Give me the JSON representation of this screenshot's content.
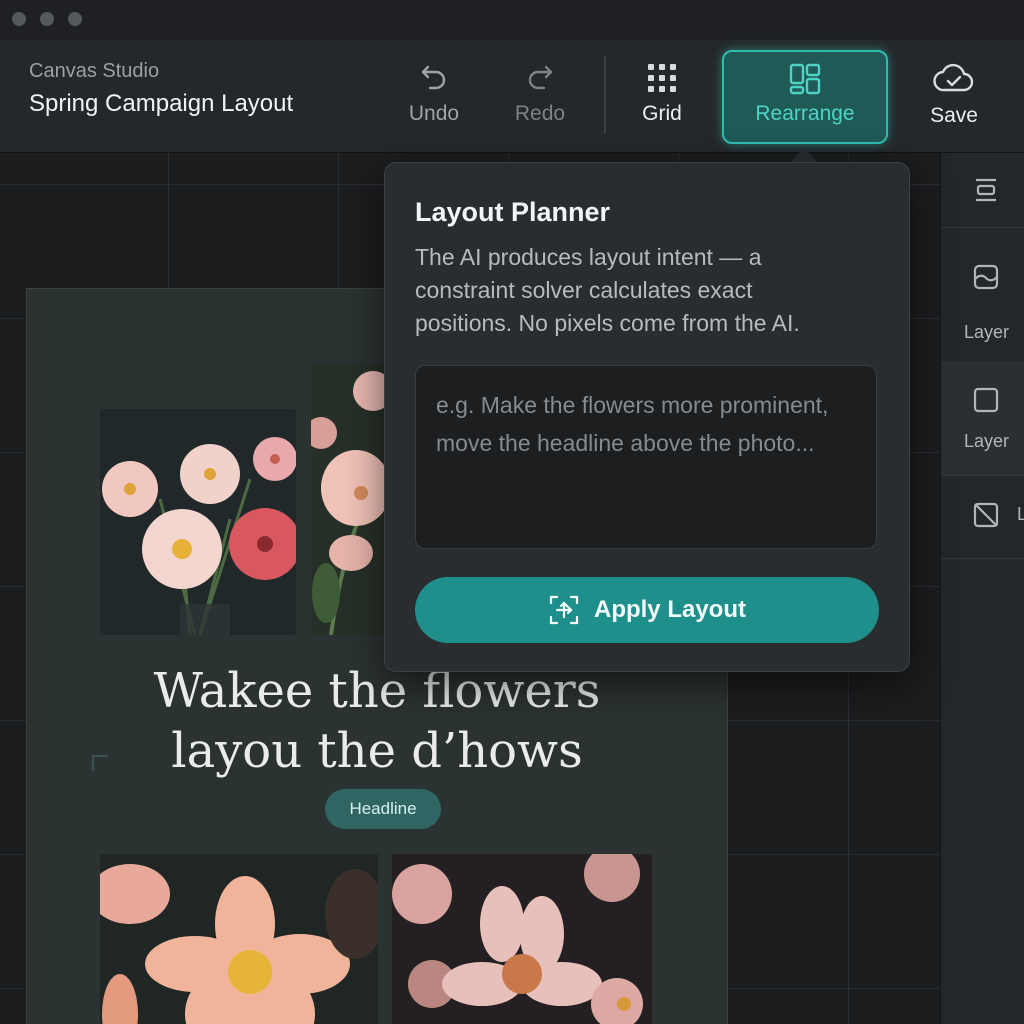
{
  "app": {
    "name": "Canvas Studio",
    "document_title": "Spring Campaign Layout"
  },
  "toolbar": {
    "undo_label": "Undo",
    "redo_label": "Redo",
    "grid_label": "Grid",
    "rearrange_label": "Rearrange",
    "save_label": "Save",
    "icons": [
      "undo-icon",
      "redo-icon",
      "grid-icon",
      "layout-icon",
      "cloud-check-icon"
    ]
  },
  "canvas": {
    "headline_line1": "Wakee the flowers",
    "headline_line2": "layou the d’hows",
    "headline_badge": "Headline",
    "photos": [
      "flower-bouquet-photo",
      "pink-flowers-photo",
      "peach-flower-photo",
      "blush-flowers-photo"
    ]
  },
  "sidebar": {
    "items": [
      {
        "icon": "align-icon",
        "label": ""
      },
      {
        "icon": "image-layer-icon",
        "label": "Layer"
      },
      {
        "icon": "square-layer-icon",
        "label": "Layer"
      },
      {
        "icon": "placeholder-icon",
        "label": "L"
      }
    ]
  },
  "popover": {
    "title": "Layout Planner",
    "description": "The AI produces layout intent — a constraint solver calculates exact positions. No pixels come from the AI.",
    "input_placeholder": "e.g. Make the flowers more prominent, move the headline above the photo...",
    "input_value": "",
    "apply_label": "Apply Layout"
  },
  "colors": {
    "accent": "#2fbcb0",
    "apply_button": "#1e8f8a",
    "badge": "#2f6663"
  }
}
